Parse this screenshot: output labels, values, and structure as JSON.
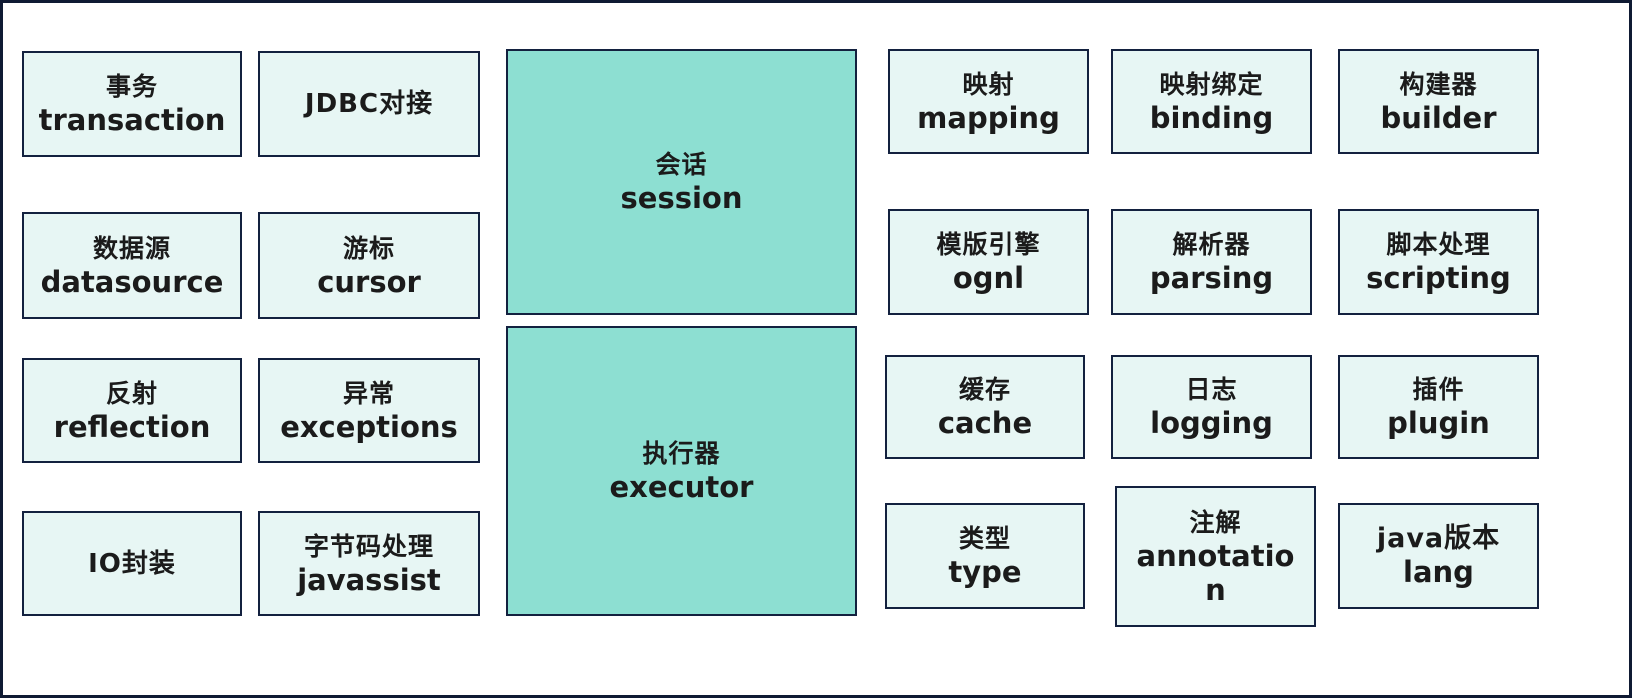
{
  "diagram": {
    "title": "",
    "colors": {
      "frame_border": "#0f1a33",
      "box_border": "#13213f",
      "box_fill": "#e7f6f4",
      "core_fill": "#8ddfd2",
      "text": "#1b1b1b"
    },
    "left_modules": [
      {
        "zh": "事务",
        "en": "transaction"
      },
      {
        "zh": "JDBC对接",
        "en": ""
      },
      {
        "zh": "数据源",
        "en": "datasource"
      },
      {
        "zh": "游标",
        "en": "cursor"
      },
      {
        "zh": "反射",
        "en": "reflection"
      },
      {
        "zh": "异常",
        "en": "exceptions"
      },
      {
        "zh": "IO封装",
        "en": ""
      },
      {
        "zh": "字节码处理",
        "en": "javassist"
      }
    ],
    "core_modules": [
      {
        "zh": "会话",
        "en": "session"
      },
      {
        "zh": "执行器",
        "en": "executor"
      }
    ],
    "right_modules": [
      {
        "zh": "映射",
        "en": "mapping"
      },
      {
        "zh": "映射绑定",
        "en": "binding"
      },
      {
        "zh": "构建器",
        "en": "builder"
      },
      {
        "zh": "模版引擎",
        "en": "ognl"
      },
      {
        "zh": "解析器",
        "en": "parsing"
      },
      {
        "zh": "脚本处理",
        "en": "scripting"
      },
      {
        "zh": "缓存",
        "en": "cache"
      },
      {
        "zh": "日志",
        "en": "logging"
      },
      {
        "zh": "插件",
        "en": "plugin"
      },
      {
        "zh": "类型",
        "en": "type"
      },
      {
        "zh": "注解",
        "en": "annotation"
      },
      {
        "zh": "java版本",
        "en": "lang"
      }
    ]
  }
}
